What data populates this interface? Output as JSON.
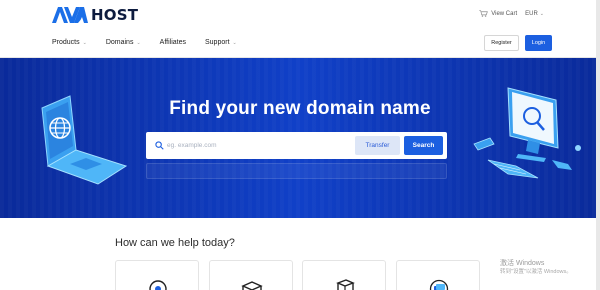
{
  "brand": {
    "logo_text": "HOST",
    "logo_mark": "AVA"
  },
  "topbar": {
    "cart_label": "View Cart",
    "currency": "EUR"
  },
  "nav": [
    {
      "label": "Products",
      "has_dropdown": true
    },
    {
      "label": "Domains",
      "has_dropdown": true
    },
    {
      "label": "Affiliates",
      "has_dropdown": false
    },
    {
      "label": "Support",
      "has_dropdown": true
    }
  ],
  "auth": {
    "register_label": "Register",
    "login_label": "Login"
  },
  "hero": {
    "title": "Find your new domain name",
    "search_placeholder": "eg. example.com",
    "transfer_label": "Transfer",
    "search_label": "Search"
  },
  "help": {
    "title": "How can we help today?"
  },
  "watermark": {
    "line1": "激活 Windows",
    "line2": "转到\"设置\"以激活 Windows。"
  },
  "colors": {
    "primary": "#1c5fe0",
    "hero_dark": "#0a2a9a",
    "hero_mid": "#1040c8",
    "logo_blue": "#1b6fe8"
  }
}
